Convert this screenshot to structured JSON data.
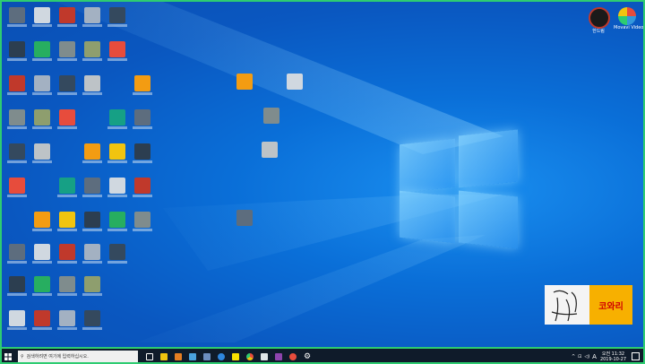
{
  "desktop_icons_right": [
    {
      "label": "한드림",
      "color": "#c0392b"
    },
    {
      "label": "Movavi Video Su...",
      "color": "#e8e8e8"
    }
  ],
  "watermark": {
    "text": "코와리"
  },
  "taskbar": {
    "search_placeholder": "검색하려면 여기에 입력하십시오.",
    "tray_icons": [
      "^",
      "⊡",
      "◁)",
      "A"
    ],
    "time": "오전 11:32",
    "date": "2019-10-27"
  },
  "colors": {
    "accent": "#2ecc71",
    "desktop": "#0a6fd8",
    "taskbar": "#0f1b2a"
  }
}
